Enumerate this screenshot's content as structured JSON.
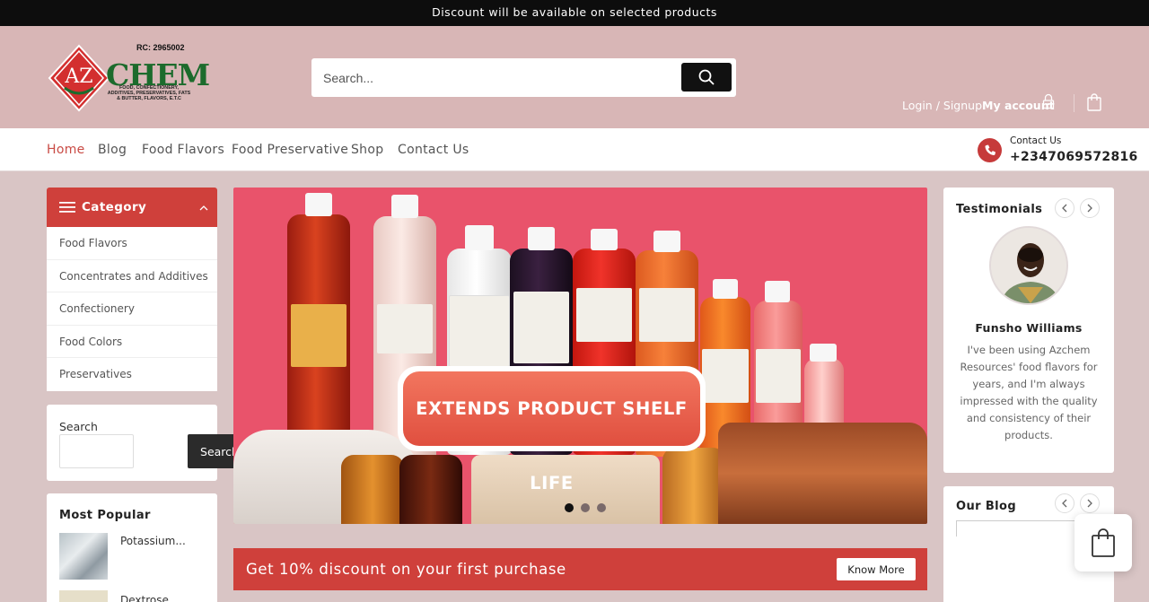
{
  "announcement": "Discount will be available on selected products",
  "logo": {
    "rc": "RC: 2965002",
    "az": "AZ",
    "chem": "CHEM",
    "tagline": "FOOD, CONFECTIONERY, ADDITIVES, PRESERVATIVES, FATS & BUTTER, FLAVORS, E.T.C"
  },
  "search": {
    "placeholder": "Search..."
  },
  "account": {
    "login": "Login / Signup",
    "my_account": "My account"
  },
  "nav": {
    "items": [
      "Home",
      "Blog",
      "Food Flavors",
      "Food Preservative",
      "Shop",
      "Contact Us"
    ],
    "active": "Home"
  },
  "contact": {
    "label": "Contact Us",
    "phone": "+2347069572816"
  },
  "category": {
    "title": "Category",
    "items": [
      "Food Flavors",
      "Concentrates and Additives",
      "Confectionery",
      "Food Colors",
      "Preservatives"
    ]
  },
  "sidebar_search": {
    "label": "Search",
    "button": "Search"
  },
  "most_popular": {
    "title": "Most Popular",
    "items": [
      {
        "name": "Potassium..."
      },
      {
        "name": "Dextrose"
      }
    ]
  },
  "hero": {
    "badge": "EXTENDS PRODUCT SHELF LIFE",
    "slides": 3,
    "active_slide": 1
  },
  "promo": {
    "text": "Get 10% discount on your first purchase",
    "button": "Know More"
  },
  "testimonials": {
    "title": "Testimonials",
    "name": "Funsho Williams",
    "quote": "I've been using Azchem Resources' food flavors for years, and I'm always impressed with the quality and consistency of their products."
  },
  "blog": {
    "title": "Our Blog"
  },
  "colors": {
    "brand_red": "#cf403b",
    "header_pink": "#d8b6b6",
    "dark": "#111111"
  }
}
